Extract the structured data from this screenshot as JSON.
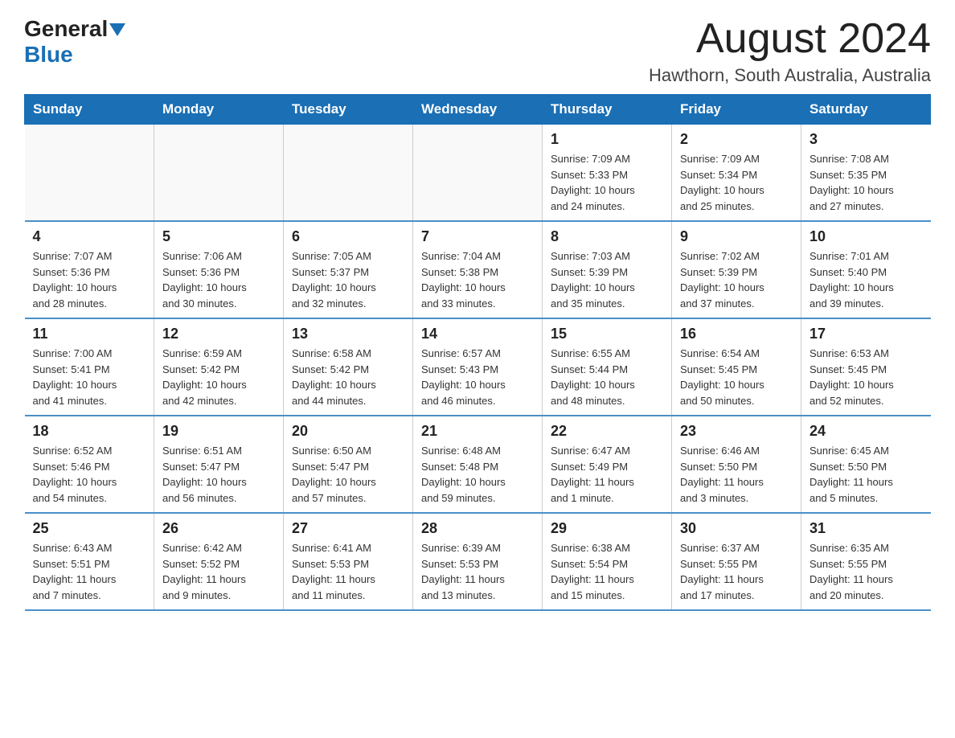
{
  "logo": {
    "general": "General",
    "arrow": "▼",
    "blue": "Blue"
  },
  "title": "August 2024",
  "subtitle": "Hawthorn, South Australia, Australia",
  "weekdays": [
    "Sunday",
    "Monday",
    "Tuesday",
    "Wednesday",
    "Thursday",
    "Friday",
    "Saturday"
  ],
  "weeks": [
    [
      {
        "day": "",
        "info": ""
      },
      {
        "day": "",
        "info": ""
      },
      {
        "day": "",
        "info": ""
      },
      {
        "day": "",
        "info": ""
      },
      {
        "day": "1",
        "info": "Sunrise: 7:09 AM\nSunset: 5:33 PM\nDaylight: 10 hours\nand 24 minutes."
      },
      {
        "day": "2",
        "info": "Sunrise: 7:09 AM\nSunset: 5:34 PM\nDaylight: 10 hours\nand 25 minutes."
      },
      {
        "day": "3",
        "info": "Sunrise: 7:08 AM\nSunset: 5:35 PM\nDaylight: 10 hours\nand 27 minutes."
      }
    ],
    [
      {
        "day": "4",
        "info": "Sunrise: 7:07 AM\nSunset: 5:36 PM\nDaylight: 10 hours\nand 28 minutes."
      },
      {
        "day": "5",
        "info": "Sunrise: 7:06 AM\nSunset: 5:36 PM\nDaylight: 10 hours\nand 30 minutes."
      },
      {
        "day": "6",
        "info": "Sunrise: 7:05 AM\nSunset: 5:37 PM\nDaylight: 10 hours\nand 32 minutes."
      },
      {
        "day": "7",
        "info": "Sunrise: 7:04 AM\nSunset: 5:38 PM\nDaylight: 10 hours\nand 33 minutes."
      },
      {
        "day": "8",
        "info": "Sunrise: 7:03 AM\nSunset: 5:39 PM\nDaylight: 10 hours\nand 35 minutes."
      },
      {
        "day": "9",
        "info": "Sunrise: 7:02 AM\nSunset: 5:39 PM\nDaylight: 10 hours\nand 37 minutes."
      },
      {
        "day": "10",
        "info": "Sunrise: 7:01 AM\nSunset: 5:40 PM\nDaylight: 10 hours\nand 39 minutes."
      }
    ],
    [
      {
        "day": "11",
        "info": "Sunrise: 7:00 AM\nSunset: 5:41 PM\nDaylight: 10 hours\nand 41 minutes."
      },
      {
        "day": "12",
        "info": "Sunrise: 6:59 AM\nSunset: 5:42 PM\nDaylight: 10 hours\nand 42 minutes."
      },
      {
        "day": "13",
        "info": "Sunrise: 6:58 AM\nSunset: 5:42 PM\nDaylight: 10 hours\nand 44 minutes."
      },
      {
        "day": "14",
        "info": "Sunrise: 6:57 AM\nSunset: 5:43 PM\nDaylight: 10 hours\nand 46 minutes."
      },
      {
        "day": "15",
        "info": "Sunrise: 6:55 AM\nSunset: 5:44 PM\nDaylight: 10 hours\nand 48 minutes."
      },
      {
        "day": "16",
        "info": "Sunrise: 6:54 AM\nSunset: 5:45 PM\nDaylight: 10 hours\nand 50 minutes."
      },
      {
        "day": "17",
        "info": "Sunrise: 6:53 AM\nSunset: 5:45 PM\nDaylight: 10 hours\nand 52 minutes."
      }
    ],
    [
      {
        "day": "18",
        "info": "Sunrise: 6:52 AM\nSunset: 5:46 PM\nDaylight: 10 hours\nand 54 minutes."
      },
      {
        "day": "19",
        "info": "Sunrise: 6:51 AM\nSunset: 5:47 PM\nDaylight: 10 hours\nand 56 minutes."
      },
      {
        "day": "20",
        "info": "Sunrise: 6:50 AM\nSunset: 5:47 PM\nDaylight: 10 hours\nand 57 minutes."
      },
      {
        "day": "21",
        "info": "Sunrise: 6:48 AM\nSunset: 5:48 PM\nDaylight: 10 hours\nand 59 minutes."
      },
      {
        "day": "22",
        "info": "Sunrise: 6:47 AM\nSunset: 5:49 PM\nDaylight: 11 hours\nand 1 minute."
      },
      {
        "day": "23",
        "info": "Sunrise: 6:46 AM\nSunset: 5:50 PM\nDaylight: 11 hours\nand 3 minutes."
      },
      {
        "day": "24",
        "info": "Sunrise: 6:45 AM\nSunset: 5:50 PM\nDaylight: 11 hours\nand 5 minutes."
      }
    ],
    [
      {
        "day": "25",
        "info": "Sunrise: 6:43 AM\nSunset: 5:51 PM\nDaylight: 11 hours\nand 7 minutes."
      },
      {
        "day": "26",
        "info": "Sunrise: 6:42 AM\nSunset: 5:52 PM\nDaylight: 11 hours\nand 9 minutes."
      },
      {
        "day": "27",
        "info": "Sunrise: 6:41 AM\nSunset: 5:53 PM\nDaylight: 11 hours\nand 11 minutes."
      },
      {
        "day": "28",
        "info": "Sunrise: 6:39 AM\nSunset: 5:53 PM\nDaylight: 11 hours\nand 13 minutes."
      },
      {
        "day": "29",
        "info": "Sunrise: 6:38 AM\nSunset: 5:54 PM\nDaylight: 11 hours\nand 15 minutes."
      },
      {
        "day": "30",
        "info": "Sunrise: 6:37 AM\nSunset: 5:55 PM\nDaylight: 11 hours\nand 17 minutes."
      },
      {
        "day": "31",
        "info": "Sunrise: 6:35 AM\nSunset: 5:55 PM\nDaylight: 11 hours\nand 20 minutes."
      }
    ]
  ]
}
